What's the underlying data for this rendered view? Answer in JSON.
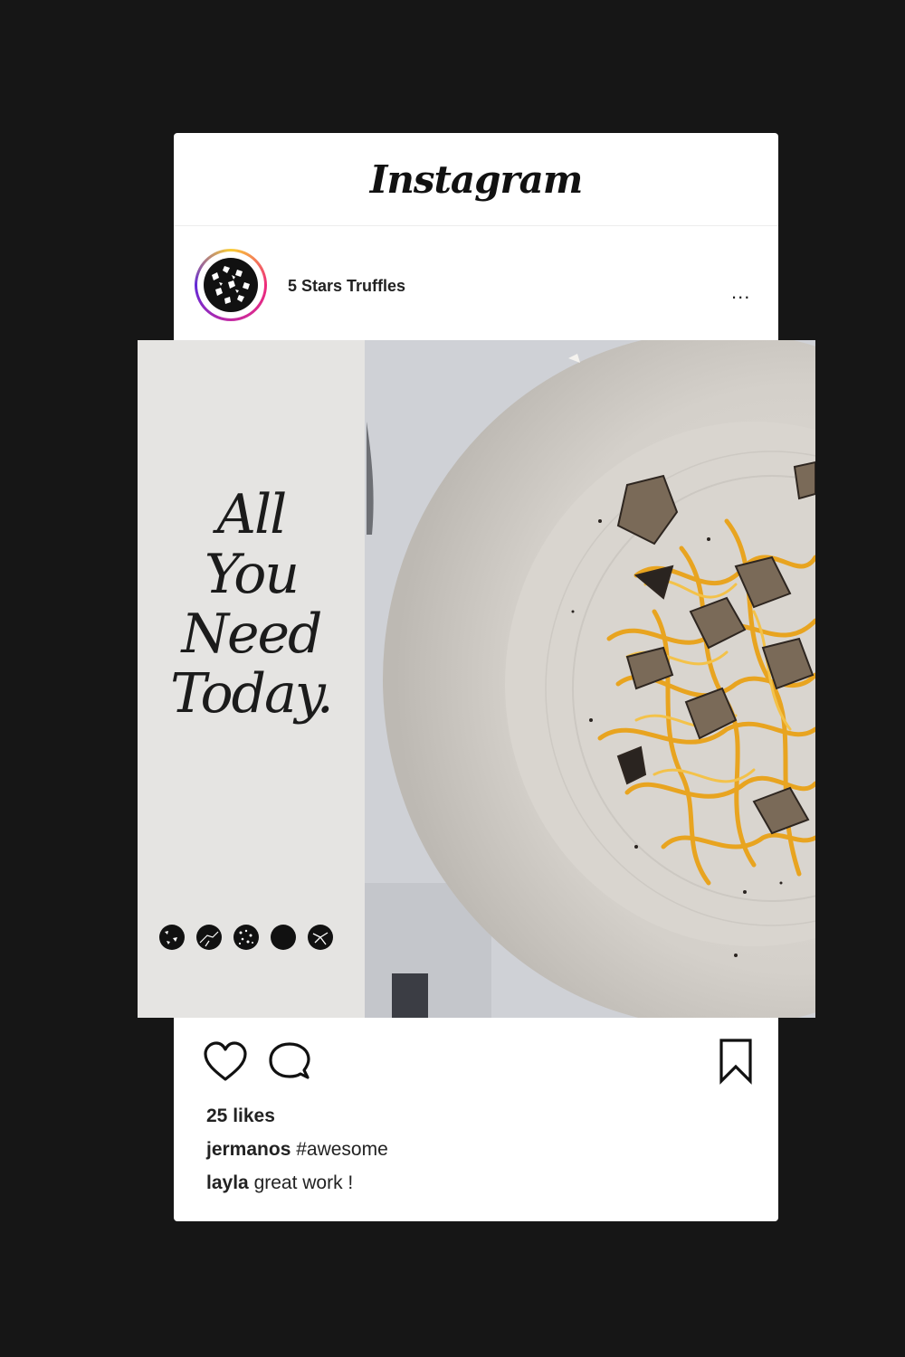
{
  "app": {
    "title": "Instagram"
  },
  "post": {
    "account_name": "5 Stars Truffles",
    "more_label": "...",
    "headline": [
      "All",
      "You",
      "Need",
      "Today."
    ],
    "likes": "25 likes",
    "comments": [
      {
        "user": "jermanos",
        "text": "#awesome"
      },
      {
        "user": "layla",
        "text": "great work !"
      }
    ]
  },
  "icons": {
    "like": "heart-icon",
    "comment": "comment-icon",
    "save": "bookmark-icon",
    "more": "more-dots-icon"
  },
  "colors": {
    "page_background": "#161616",
    "card": "#ffffff",
    "avatar_ring": [
      "#f9ce34",
      "#ee2a7b",
      "#6228d7"
    ],
    "text": "#222222"
  }
}
